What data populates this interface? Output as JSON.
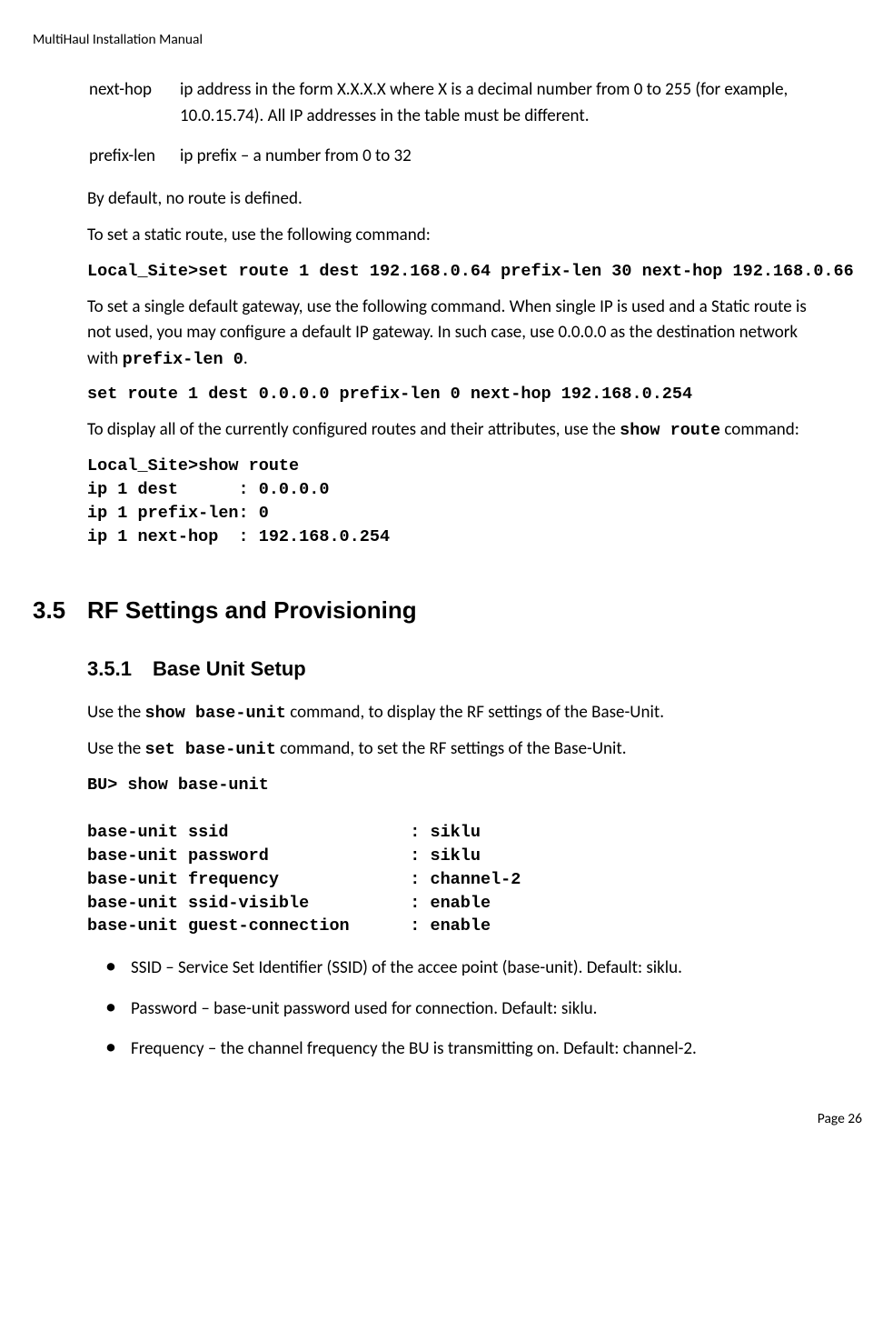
{
  "header": "MultiHaul Installation Manual",
  "params": {
    "nexthop": {
      "name": "next-hop",
      "desc": "ip address in the form X.X.X.X where X is a decimal number from 0 to 255 (for example, 10.0.15.74). All IP addresses in the table must be different."
    },
    "prefixlen": {
      "name": "prefix-len",
      "desc": "ip prefix – a number from 0 to 32"
    }
  },
  "body": {
    "p1": "By default, no route is defined.",
    "p2": "To set a static route, use the following command:",
    "code1": "Local_Site>set route 1 dest 192.168.0.64 prefix-len 30 next-hop 192.168.0.66",
    "p3a": "To set a single default gateway, use the following command. When single IP is used and a Static route is not used, you may configure a default IP gateway. In such case, use 0.0.0.0 as the destination network with ",
    "p3b": "prefix-len 0",
    "p3c": ".",
    "code2": "set route 1 dest 0.0.0.0 prefix-len 0 next-hop 192.168.0.254",
    "p4a": "To display all of the currently configured routes and their attributes, use the ",
    "p4b": "show route",
    "p4c": " command:",
    "code3": "Local_Site>show route\nip 1 dest      : 0.0.0.0\nip 1 prefix-len: 0\nip 1 next-hop  : 192.168.0.254"
  },
  "sec35": {
    "num": "3.5",
    "title": "RF Settings and Provisioning"
  },
  "sec351": {
    "num": "3.5.1",
    "title": "Base Unit Setup",
    "p1a": "Use the ",
    "p1b": "show base-unit",
    "p1c": " command, to display the RF settings of the Base-Unit.",
    "p2a": "Use the ",
    "p2b": "set base-unit",
    "p2c": " command, to set the RF settings of the Base-Unit.",
    "code": "BU> show base-unit\n\nbase-unit ssid                  : siklu\nbase-unit password              : siklu\nbase-unit frequency             : channel-2\nbase-unit ssid-visible          : enable\nbase-unit guest-connection      : enable",
    "bullets": {
      "b1": "SSID – Service Set Identifier (SSID) of the accee point (base-unit). Default: siklu.",
      "b2": "Password – base-unit password used for connection. Default: siklu.",
      "b3": "Frequency – the channel frequency the BU is transmitting on. Default: channel-2."
    }
  },
  "footer": "Page 26"
}
